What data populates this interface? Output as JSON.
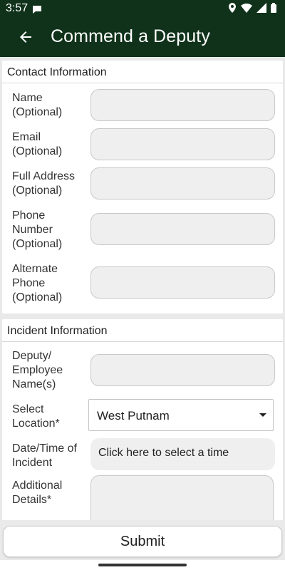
{
  "status": {
    "time": "3:57"
  },
  "appbar": {
    "title": "Commend a Deputy"
  },
  "contact": {
    "header": "Contact Information",
    "fields": [
      {
        "label": "Name (Optional)",
        "value": ""
      },
      {
        "label": "Email (Optional)",
        "value": ""
      },
      {
        "label": "Full Address (Optional)",
        "value": ""
      },
      {
        "label": "Phone Number (Optional)",
        "value": ""
      },
      {
        "label": "Alternate Phone (Optional)",
        "value": ""
      }
    ]
  },
  "incident": {
    "header": "Incident Information",
    "deputy_label": "Deputy/ Employee Name(s)",
    "location_label": "Select Location*",
    "location_value": "West Putnam",
    "datetime_label": "Date/Time of Incident",
    "datetime_button": "Click here to select a time",
    "details_label": "Additional Details*"
  },
  "submit_label": "Submit",
  "colors": {
    "header_bg": "#10321a"
  }
}
